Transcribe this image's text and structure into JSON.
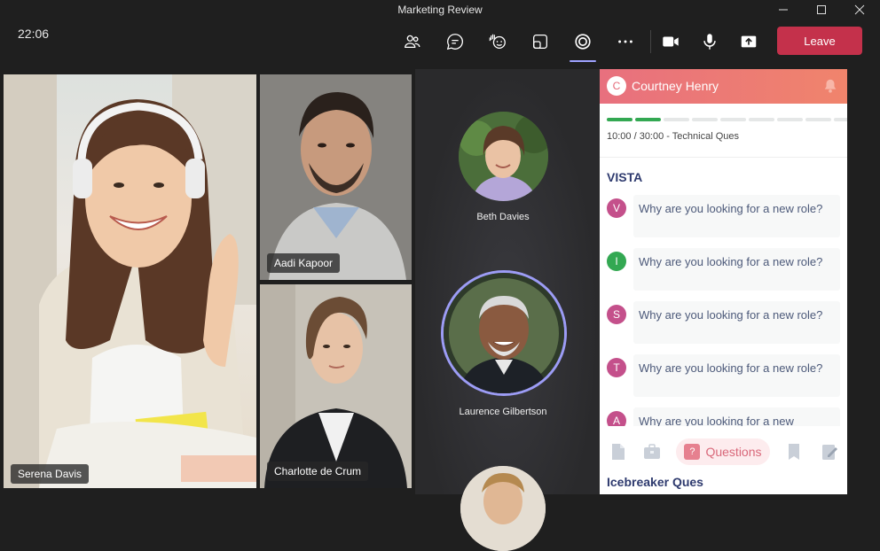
{
  "window": {
    "title": "Marketing Review"
  },
  "toolbar": {
    "time": "22:06",
    "leave_label": "Leave",
    "icons": [
      "people-icon",
      "chat-icon",
      "raise-hand-icon",
      "view-icon",
      "apps-icon",
      "more-icon",
      "camera-icon",
      "mic-icon",
      "share-icon"
    ]
  },
  "participants": {
    "tiles": [
      {
        "name": "Serena Davis"
      },
      {
        "name": "Aadi Kapoor"
      },
      {
        "name": "Charlotte de Crum"
      }
    ],
    "circles": [
      {
        "name": "Beth Davies"
      },
      {
        "name": "Laurence Gilbertson"
      }
    ]
  },
  "panel": {
    "candidate_initial": "C",
    "candidate_name": "Courtney Henry",
    "progress_filled": 2,
    "progress_total": 9,
    "timer_text": "10:00 / 30:00 - Technical Ques",
    "section_title": "VISTA",
    "questions": [
      {
        "letter": "V",
        "color": "#c4508b",
        "text": "Why are you looking for a new role?"
      },
      {
        "letter": "I",
        "color": "#33a852",
        "text": "Why are you looking for a new role?"
      },
      {
        "letter": "S",
        "color": "#c4508b",
        "text": "Why are you looking for a new role?"
      },
      {
        "letter": "T",
        "color": "#c4508b",
        "text": "Why are you looking for a new role?"
      },
      {
        "letter": "A",
        "color": "#c4508b",
        "text": "Why are you looking for a new"
      }
    ],
    "footer_tab_label": "Questions",
    "footer_tab_badge": "?",
    "next_section_title": "Icebreaker Ques"
  }
}
